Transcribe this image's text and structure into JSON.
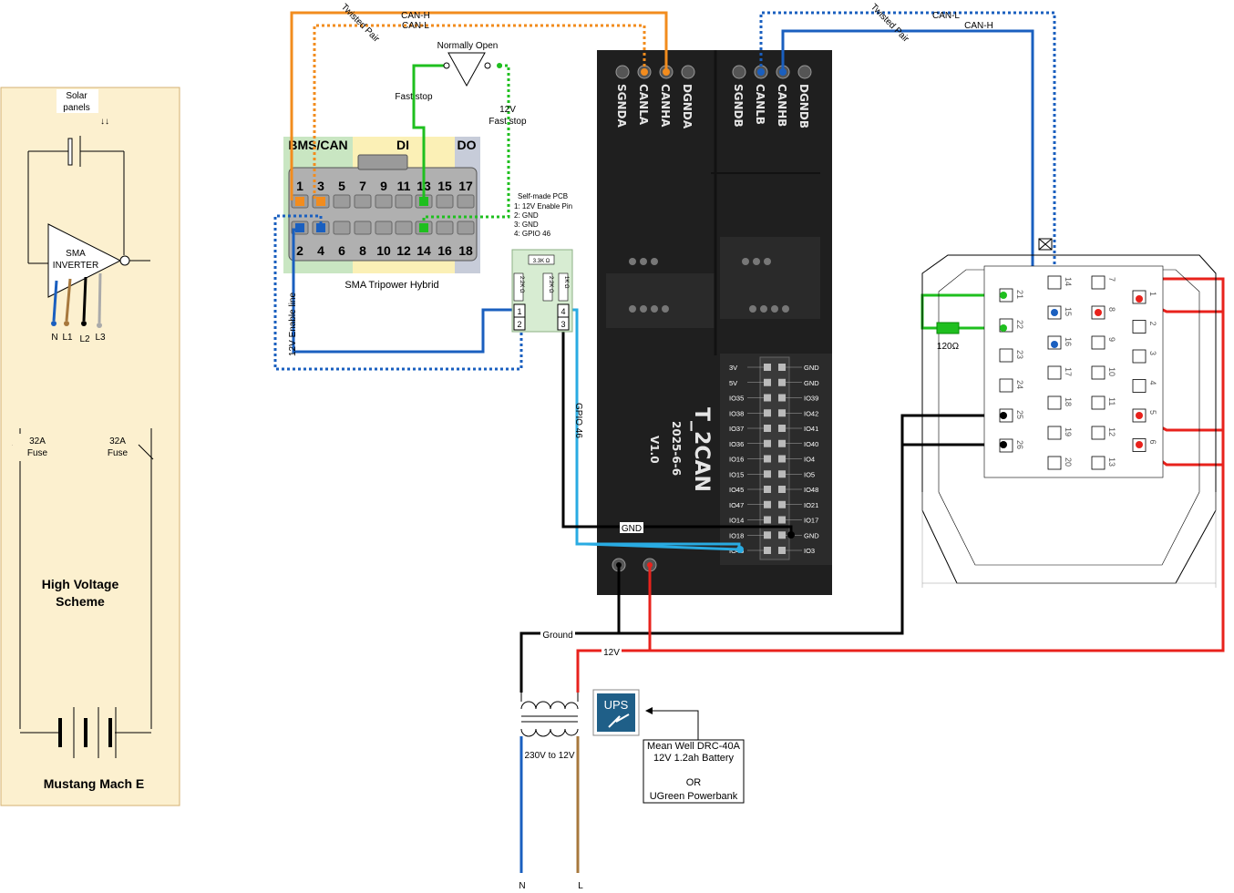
{
  "hv_panel": {
    "solar_label": "Solar panels",
    "inverter_label": "SMA INVERTER",
    "phase_labels": [
      "N",
      "L1",
      "L2",
      "L3"
    ],
    "fuse_label": "32A Fuse",
    "title": "High Voltage Scheme",
    "car": "Mustang Mach E"
  },
  "sma_connector": {
    "header_bms": "BMS/CAN",
    "header_di": "DI",
    "header_do": "DO",
    "top_pins": [
      "1",
      "3",
      "5",
      "7",
      "9",
      "11",
      "13",
      "15",
      "17"
    ],
    "bottom_pins": [
      "2",
      "4",
      "6",
      "8",
      "10",
      "12",
      "14",
      "16",
      "18"
    ],
    "caption": "SMA Tripower Hybrid"
  },
  "wiring_labels": {
    "twisted_pair": "Twisted Pair",
    "can_h": "CAN-H",
    "can_l": "CAN-L",
    "normally_open": "Normally Open",
    "fast_stop": "Fast stop",
    "fast_stop_12v": "12V Fast stop",
    "enable_line": "12V Enable line",
    "gpio46": "GPIO 46",
    "gnd": "GND",
    "ground": "Ground",
    "v12": "12V",
    "resistor_120": "120Ω",
    "transformer": "230V to 12V",
    "mains_n": "N",
    "mains_l": "L"
  },
  "pcb": {
    "title": "Self-made PCB",
    "pins": [
      "1: 12V Enable Pin",
      "2: GND",
      "3: GND",
      "4: GPIO 46"
    ],
    "r1": "3.3K Ω",
    "r2": "2.2K Ω",
    "r3": "2.2K Ω",
    "r4": "1K Ω",
    "pin_nums": [
      "1",
      "2",
      "4",
      "3"
    ]
  },
  "t2can": {
    "name": "T_2CAN",
    "date": "2025-6-6",
    "version": "V1.0",
    "top_pins_a": [
      "SGNDA",
      "CANLA",
      "CANHA",
      "DGNDA"
    ],
    "top_pins_b": [
      "SGNDB",
      "CANLB",
      "CANHB",
      "DGNDB"
    ],
    "left_io": [
      "3V",
      "5V",
      "IO35",
      "IO38",
      "IO37",
      "IO36",
      "IO16",
      "IO15",
      "IO45",
      "IO47",
      "IO14",
      "IO18",
      "IO46"
    ],
    "right_io": [
      "GND",
      "GND",
      "IO39",
      "IO42",
      "IO41",
      "IO40",
      "IO4",
      "IO5",
      "IO48",
      "IO21",
      "IO17",
      "GND",
      "IO3"
    ]
  },
  "car_connector": {
    "col1": [
      "21",
      "22",
      "23",
      "24",
      "25",
      "26"
    ],
    "col2": [
      "14",
      "15",
      "16",
      "17",
      "18",
      "19",
      "20"
    ],
    "col3": [
      "7",
      "8",
      "9",
      "10",
      "11",
      "12",
      "13"
    ],
    "col4": [
      "1",
      "2",
      "3",
      "4",
      "5",
      "6"
    ]
  },
  "ups": {
    "badge": "UPS",
    "line1": "Mean Well DRC-40A",
    "line2": "12V 1.2ah Battery",
    "or": "OR",
    "alt": "UGreen Powerbank"
  },
  "colors": {
    "orange": "#f28c1e",
    "green": "#1fbf1f",
    "blue": "#1a5fbf",
    "cyan": "#29abe2",
    "red": "#e8221c",
    "black": "#000000",
    "panel": "#fcf0cf",
    "board": "#1f1f1f"
  }
}
